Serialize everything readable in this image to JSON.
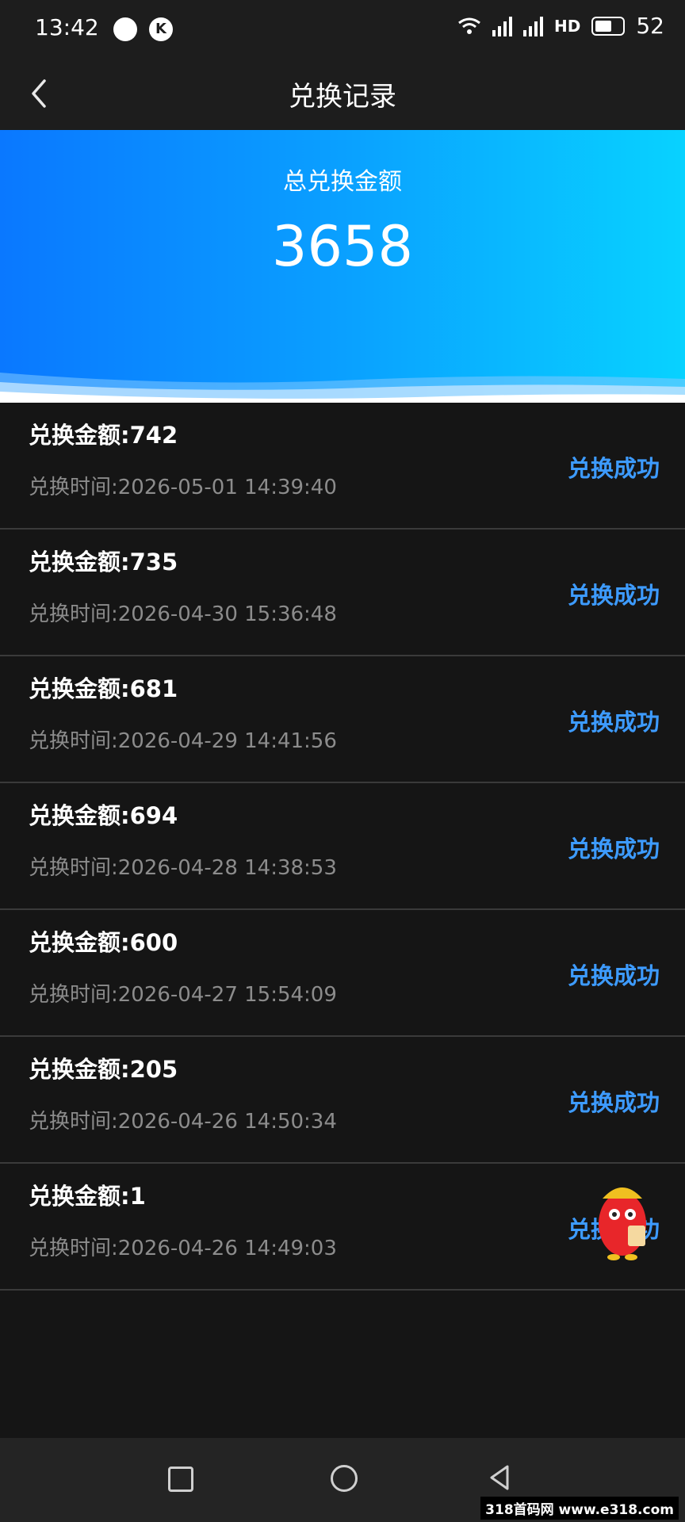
{
  "status_bar": {
    "time": "13:42",
    "k_badge": "K",
    "hd_label": "HD",
    "battery_level": "52"
  },
  "header": {
    "title": "兑换记录"
  },
  "summary": {
    "label": "总兑换金额",
    "total": "3658"
  },
  "records": [
    {
      "amount": "兑换金额:742",
      "time": "兑换时间:2026-05-01 14:39:40",
      "status": "兑换成功"
    },
    {
      "amount": "兑换金额:735",
      "time": "兑换时间:2026-04-30 15:36:48",
      "status": "兑换成功"
    },
    {
      "amount": "兑换金额:681",
      "time": "兑换时间:2026-04-29 14:41:56",
      "status": "兑换成功"
    },
    {
      "amount": "兑换金额:694",
      "time": "兑换时间:2026-04-28 14:38:53",
      "status": "兑换成功"
    },
    {
      "amount": "兑换金额:600",
      "time": "兑换时间:2026-04-27 15:54:09",
      "status": "兑换成功"
    },
    {
      "amount": "兑换金额:205",
      "time": "兑换时间:2026-04-26 14:50:34",
      "status": "兑换成功"
    },
    {
      "amount": "兑换金额:1",
      "time": "兑换时间:2026-04-26 14:49:03",
      "status": "兑换成功"
    }
  ],
  "watermark": "318首码网 www.e318.com",
  "colors": {
    "status_text": "#3d9bff",
    "banner_start": "#0a78ff",
    "banner_end": "#08d2ff"
  }
}
